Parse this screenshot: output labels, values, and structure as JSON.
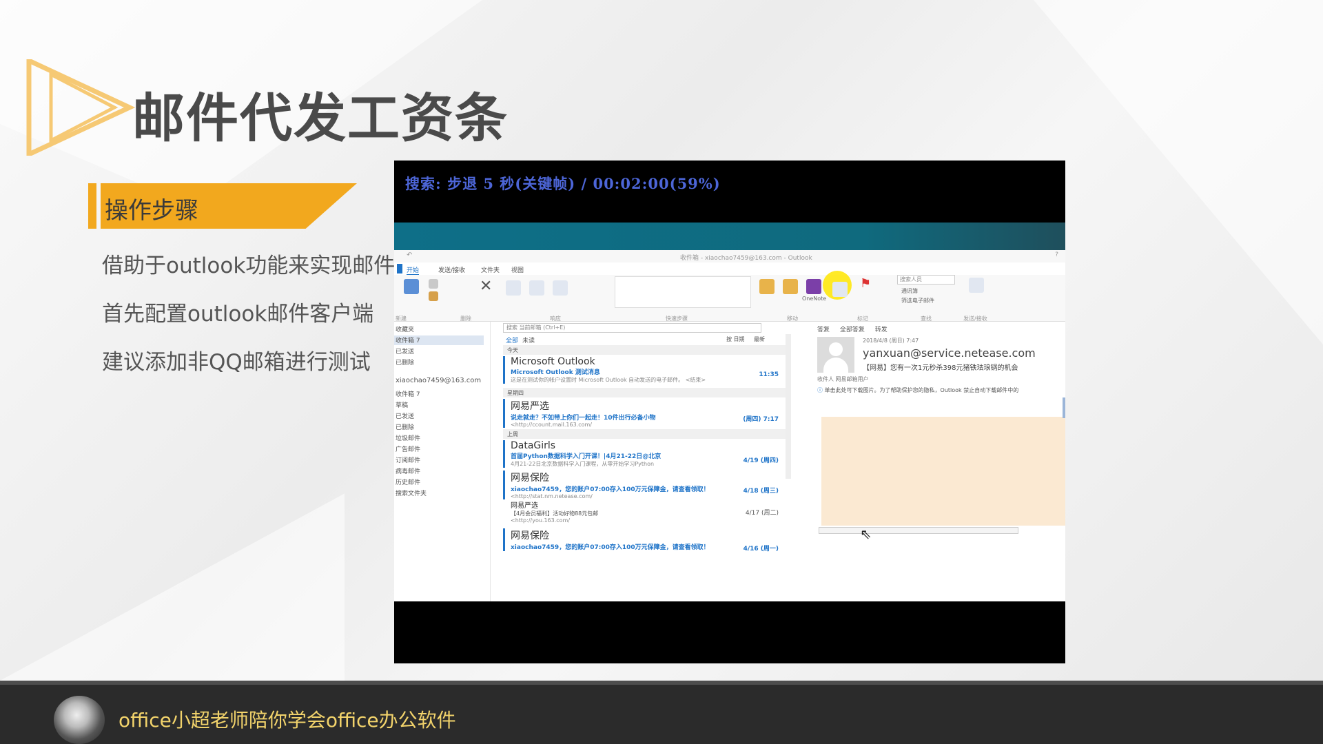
{
  "slide": {
    "title": "邮件代发工资条",
    "step_label": "操作步骤",
    "bullets": [
      "借助于outlook功能来实现邮件",
      "首先配置outlook邮件客户端",
      "建议添加非QQ邮箱进行测试"
    ]
  },
  "video": {
    "osd_text": "搜索: 步退 5 秒(关键帧) / 00:02:00(59%)"
  },
  "outlook": {
    "window_title": "收件箱 - xiaochao7459@163.com - Outlook",
    "tabs": [
      "文件",
      "开始",
      "发送/接收",
      "文件夹",
      "视图"
    ],
    "ribbon_groups": [
      "新建",
      "删除",
      "响应",
      "快速步骤",
      "移动",
      "标记",
      "查找",
      "发送/接收"
    ],
    "ribbon_labels": {
      "onenote": "OneNote",
      "search_people": "搜索人员",
      "address_book": "通讯簿",
      "filter_email": "筛选电子邮件"
    },
    "folders": [
      "收藏夹",
      "收件箱 7",
      "已发送",
      "已删除",
      "xiaochao7459@163.com",
      "收件箱 7",
      "草稿",
      "已发送",
      "已删除",
      "垃圾邮件",
      "广告邮件",
      "订阅邮件",
      "病毒邮件",
      "历史邮件",
      "搜索文件夹"
    ],
    "search_placeholder": "搜索 当前邮箱 (Ctrl+E)",
    "filter_all": "全部",
    "filter_unread": "未读",
    "sort_label": "按 日期",
    "sort_order": "最新",
    "groups": [
      "今天",
      "星期四",
      "上周"
    ],
    "messages": [
      {
        "sender": "Microsoft Outlook",
        "subject": "Microsoft Outlook 测试消息",
        "preview": "这是在测试你的帐户设置时 Microsoft Outlook 自动发送的电子邮件。 <结束>",
        "time": "11:35"
      },
      {
        "sender": "网易严选",
        "subject": "说走就走？不如带上你们一起走！10件出行必备小物",
        "preview": "<http://ccount.mail.163.com/",
        "time": "(周四) 7:17"
      },
      {
        "sender": "DataGirls",
        "subject": "首届Python数据科学入门开课！|4月21-22日@北京",
        "preview": "4月21-22日北京数据科学入门课程，从零开始学习Python",
        "time": "4/19 (周四)"
      },
      {
        "sender": "网易保险",
        "subject": "xiaochao7459，您的账户07:00存入100万元保障金，请查看领取！",
        "preview": "<http://stat.nm.netease.com/",
        "time": "4/18 (周三)"
      },
      {
        "sender": "网易严选",
        "subject": "【4月会员福利】活动好物88元包邮",
        "preview": "<http://you.163.com/",
        "time": "4/17 (周二)"
      },
      {
        "sender": "网易保险",
        "subject": "xiaochao7459，您的账户07:00存入100万元保障金，请查看领取！",
        "preview": "",
        "time": "4/16 (周一)"
      }
    ],
    "reading": {
      "actions": [
        "答复",
        "全部答复",
        "转发"
      ],
      "date": "2018/4/8 (周日) 7:47",
      "from": "yanxuan@service.netease.com",
      "subject": "【网易】您有一次1元秒杀398元猪铁珐琅锅的机会",
      "to": "收件人  网易邮箱用户",
      "notice": "单击此处可下载图片。为了帮助保护您的隐私，Outlook 禁止自动下载邮件中的"
    }
  },
  "footer": {
    "channel_name": "office小超老师陪你学会office办公软件"
  },
  "colors": {
    "accent": "#f2a81e",
    "outlook_blue": "#1e73c8",
    "osd_blue": "#4d66d8"
  }
}
